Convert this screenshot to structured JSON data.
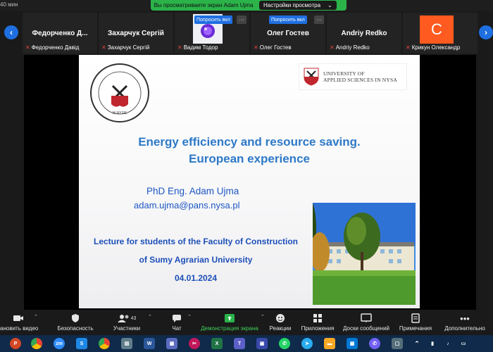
{
  "meeting": {
    "timer": "40 мин",
    "share_banner": "Вы просматриваете экран Adam Ujma",
    "view_settings_label": "Настройки просмотра"
  },
  "gallery": {
    "request_label": "Попросить вкл",
    "more_label": "···",
    "participants": [
      {
        "display_name": "Федорченко Д...",
        "label": "Федорченко Давід"
      },
      {
        "display_name": "Захарчук Сергій",
        "label": "Захарчук Сергій"
      },
      {
        "display_name": "",
        "label": "Вадим Тодор"
      },
      {
        "display_name": "Олег Гостев",
        "label": "Олег Гостев"
      },
      {
        "display_name": "Andriy Redko",
        "label": "Andriy Redko"
      },
      {
        "display_name": "",
        "label": "Крикун Олександр",
        "avatar_letter": "C"
      }
    ]
  },
  "slide": {
    "university_logo_text_line1": "UNIVERSITY OF",
    "university_logo_text_line2": "APPLIED SCIENCES IN NYSA",
    "seal_text": "PAŃSTWOWA AKADEMIA NAUK STOSOWANYCH · W NYSIE ·",
    "title_line1": "Energy efficiency and resource saving.",
    "title_line2": "European experience",
    "author": "PhD Eng. Adam Ujma",
    "email": "adam.ujma@pans.nysa.pl",
    "lecture_line1": "Lecture for students of the Faculty of Construction",
    "lecture_line2": "of Sumy Agrarian University",
    "date": "04.01.2024"
  },
  "toolbar": {
    "items": [
      {
        "label": "ановить видео",
        "icon": "camera-icon"
      },
      {
        "label": "Безопасность",
        "icon": "shield-icon"
      },
      {
        "label": "Участники",
        "icon": "participants-icon",
        "count": "43"
      },
      {
        "label": "Чат",
        "icon": "chat-icon"
      },
      {
        "label": "Демонстрация экрана",
        "icon": "share-screen-icon"
      },
      {
        "label": "Реакции",
        "icon": "reactions-icon"
      },
      {
        "label": "Приложения",
        "icon": "apps-icon"
      },
      {
        "label": "Доски сообщений",
        "icon": "whiteboard-icon"
      },
      {
        "label": "Примечания",
        "icon": "notes-icon"
      },
      {
        "label": "Дополнительно",
        "icon": "more-icon"
      }
    ]
  },
  "colors": {
    "share_green": "#2bb34a",
    "zoom_blue": "#1f6fe0",
    "title_blue": "#2e79c7",
    "avatar_orange": "#ff5a1f",
    "taskbar": "#0f2a4a"
  },
  "taskbar": {
    "icons": [
      "powerpoint-icon",
      "chrome-icon",
      "zoom-icon",
      "s-app-icon",
      "chrome-icon",
      "file-manager-icon",
      "word-icon",
      "screenshot-icon",
      "excel-icon",
      "teams-icon",
      "save-icon",
      "whatsapp-icon",
      "telegram-icon",
      "folder-icon",
      "store-icon",
      "viber-icon"
    ]
  }
}
